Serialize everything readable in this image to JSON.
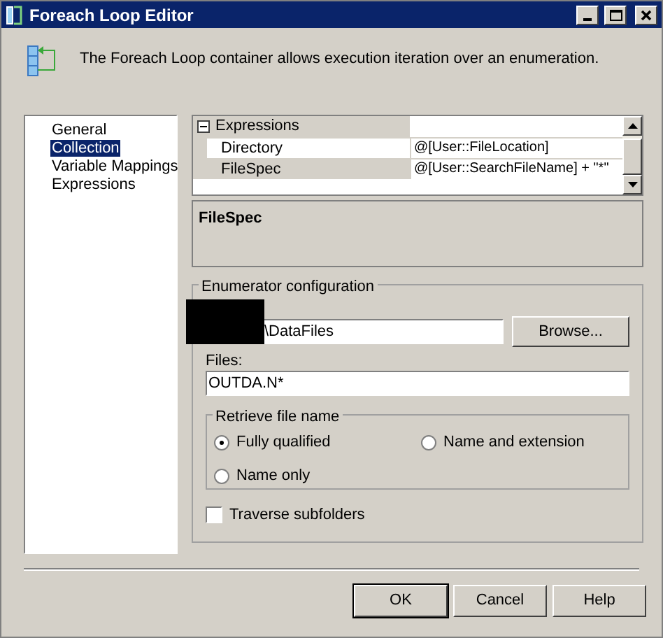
{
  "window": {
    "title": "Foreach Loop Editor",
    "description": "The Foreach Loop container allows execution iteration over an enumeration."
  },
  "sidebar": {
    "items": [
      {
        "label": "General",
        "selected": false
      },
      {
        "label": "Collection",
        "selected": true
      },
      {
        "label": "Variable Mappings",
        "selected": false
      },
      {
        "label": "Expressions",
        "selected": false
      }
    ]
  },
  "property_grid": {
    "category": "Expressions",
    "expanded": true,
    "rows": [
      {
        "name": "Directory",
        "value": "@[User::FileLocation]",
        "selected": false
      },
      {
        "name": "FileSpec",
        "value": "@[User::SearchFileName] + \"*\"",
        "selected": true
      }
    ]
  },
  "description_panel": {
    "title": "FileSpec"
  },
  "enumerator": {
    "title": "Enumerator configuration",
    "folder_value": "\\DataFiles",
    "browse_button": "Browse...",
    "files_label": "Files:",
    "files_value": "OUTDA.N*",
    "retrieve": {
      "title": "Retrieve file name",
      "options": [
        {
          "label": "Fully qualified",
          "selected": true
        },
        {
          "label": "Name and extension",
          "selected": false
        },
        {
          "label": "Name only",
          "selected": false
        }
      ]
    },
    "traverse": {
      "label": "Traverse subfolders",
      "checked": false
    }
  },
  "buttons": [
    "OK",
    "Cancel",
    "Help"
  ]
}
